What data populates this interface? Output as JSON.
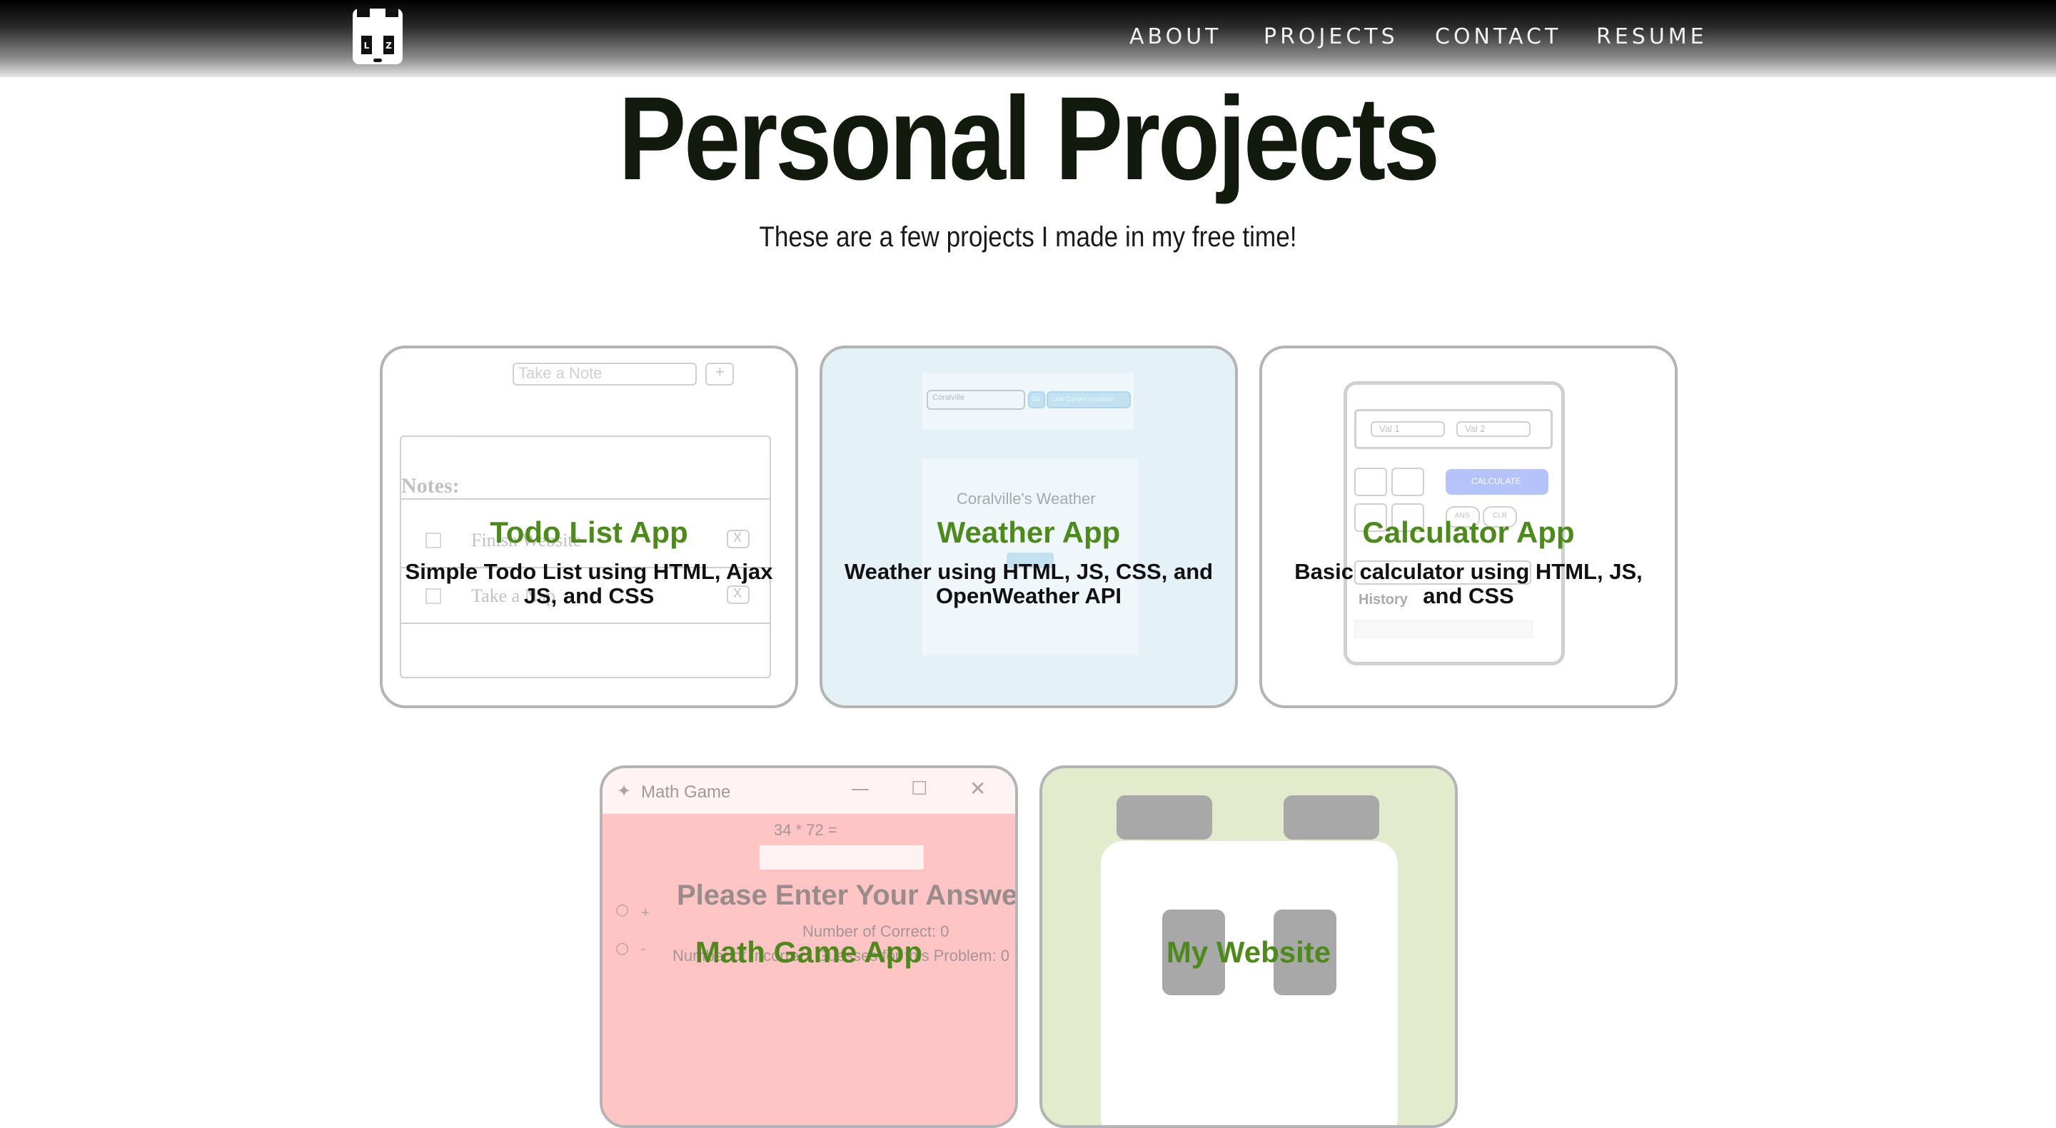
{
  "header": {
    "logo": {
      "left_letter": "L",
      "right_letter": "Z"
    },
    "nav": [
      {
        "label": "ABOUT"
      },
      {
        "label": "PROJECTS"
      },
      {
        "label": "CONTACT"
      },
      {
        "label": "RESUME"
      }
    ]
  },
  "hero": {
    "title": "Personal Projects",
    "subtitle": "These are a few projects I made in my free time!"
  },
  "projects": [
    {
      "name": "Todo List App",
      "description": "Simple Todo List using HTML, Ajax JS, and CSS",
      "preview": {
        "input_placeholder": "Take a Note",
        "add_button": "+",
        "notes_heading": "Notes:",
        "notes": [
          "Finish Website",
          "Take a Nap"
        ],
        "delete_label": "X"
      }
    },
    {
      "name": "Weather App",
      "description": "Weather using HTML, JS, CSS, and OpenWeather API",
      "preview": {
        "city_input": "Coralville",
        "go_button": "Go",
        "location_button": "Use Current Location",
        "weather_heading": "Coralville's Weather"
      }
    },
    {
      "name": "Calculator App",
      "description": "Basic calculator using HTML, JS, and CSS",
      "preview": {
        "val1_placeholder": "Val 1",
        "val2_placeholder": "Val 2",
        "calculate_button": "CALCULATE",
        "ans_button": "ANS",
        "clr_button": "CLR",
        "history_label": "History"
      }
    },
    {
      "name": "Math Game App",
      "description": "",
      "preview": {
        "window_title": "Math Game",
        "question": "34 * 72 =",
        "prompt": "Please Enter Your Answer",
        "correct_count": "Number of Correct: 0",
        "incorrect_count": "Number of Incorrect Guesses for this Problem: 0",
        "options": [
          "+",
          "-"
        ]
      }
    },
    {
      "name": "My Website",
      "description": ""
    }
  ],
  "colors": {
    "accent_green": "#4c8a1a",
    "weather_bg": "#cde6f0",
    "math_bg": "#ffc2c2",
    "website_bg": "#d6e8b4"
  }
}
